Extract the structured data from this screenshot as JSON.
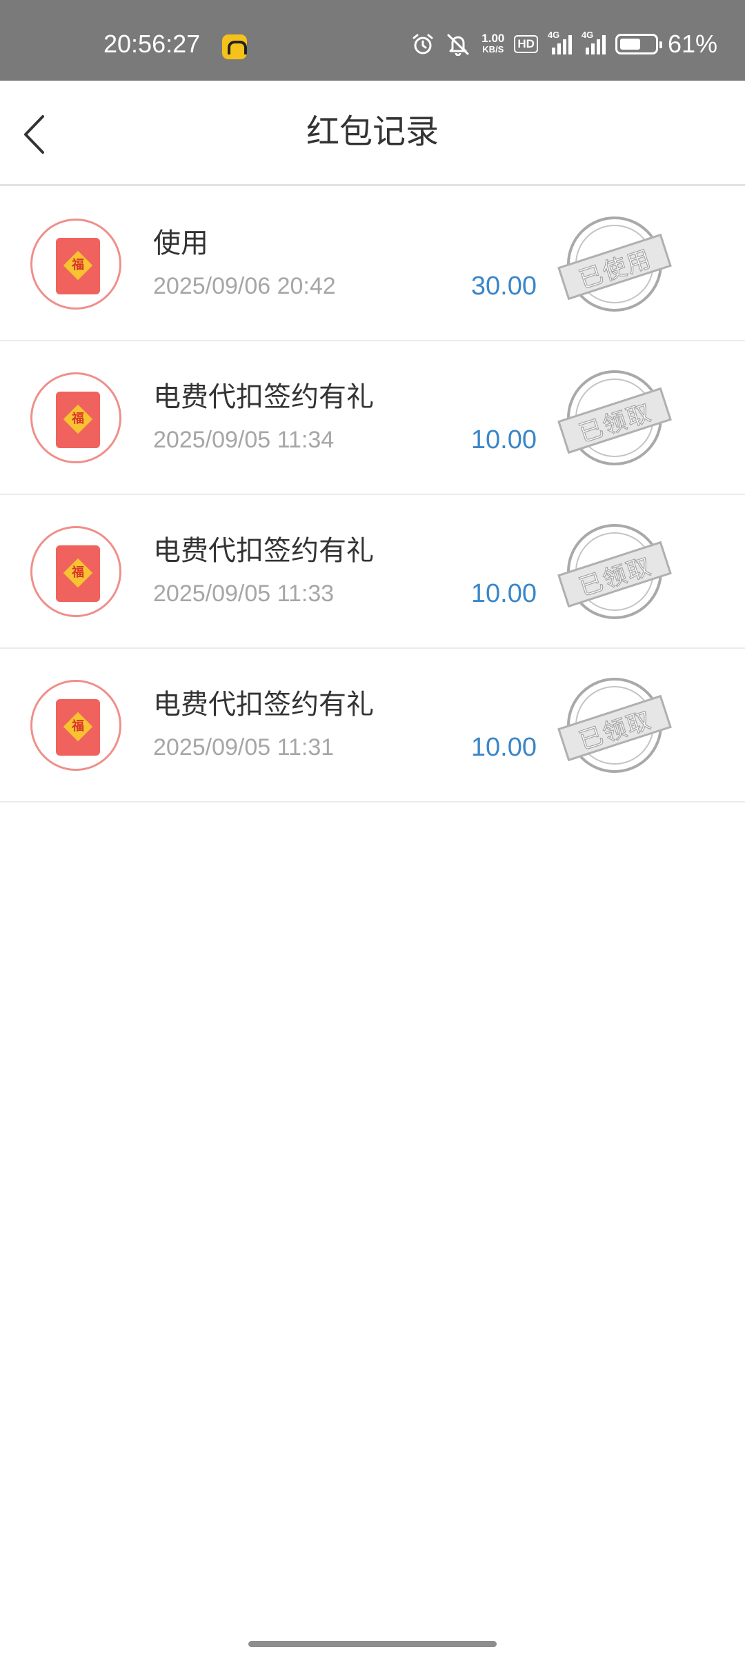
{
  "status_bar": {
    "time": "20:56:27",
    "network_speed_value": "1.00",
    "network_speed_unit": "KB/S",
    "hd_label": "HD",
    "signal1_label": "4G",
    "signal2_label": "4G",
    "battery_percent_text": "61%",
    "battery_level": 0.61,
    "icons": [
      "alarm-icon",
      "mute-icon",
      "hd-icon",
      "signal-icon",
      "battery-icon"
    ]
  },
  "header": {
    "back_icon": "chevron-left-icon",
    "title": "红包记录"
  },
  "records": [
    {
      "title": "使用",
      "date": "2025/09/06 20:42",
      "amount": "30.00",
      "stamp": "已使用"
    },
    {
      "title": "电费代扣签约有礼",
      "date": "2025/09/05 11:34",
      "amount": "10.00",
      "stamp": "已领取"
    },
    {
      "title": "电费代扣签约有礼",
      "date": "2025/09/05 11:33",
      "amount": "10.00",
      "stamp": "已领取"
    },
    {
      "title": "电费代扣签约有礼",
      "date": "2025/09/05 11:31",
      "amount": "10.00",
      "stamp": "已领取"
    }
  ],
  "envelope_char": "福",
  "colors": {
    "status_bar_bg": "#7a7a7a",
    "amount_blue": "#3a86c8",
    "envelope_red": "#f0625e",
    "envelope_gold": "#f7c330",
    "stamp_gray": "#a9a9a9"
  }
}
